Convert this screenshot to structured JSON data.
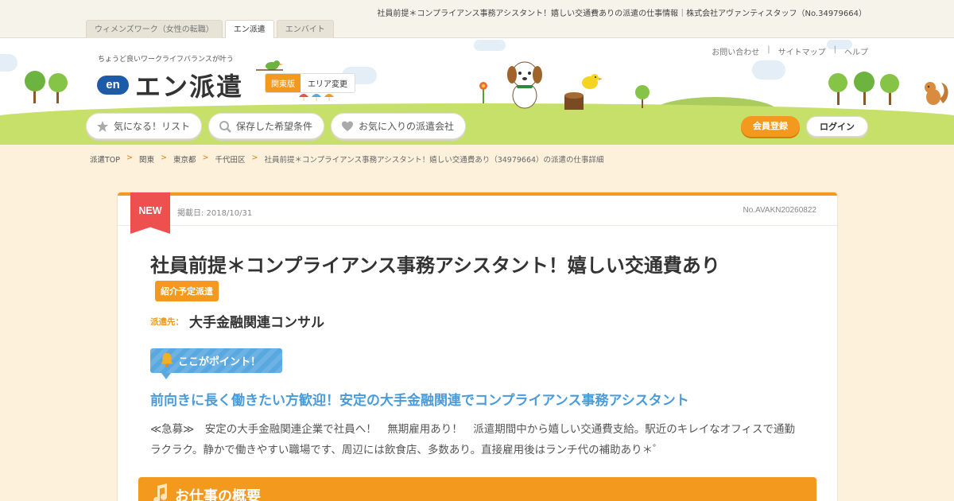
{
  "page_heading": "社員前提＊コンプライアンス事務アシスタント！嬉しい交通費ありの派遣の仕事情報｜株式会社アヴァンティスタッフ（No.34979664）",
  "site_tabs": [
    {
      "label": "ウィメンズワーク（女性の転職）",
      "active": false
    },
    {
      "label": "エン派遣",
      "active": true
    },
    {
      "label": "エンバイト",
      "active": false
    }
  ],
  "header": {
    "tagline": "ちょうど良いワークライフバランスが叶う",
    "logo_mark": "en",
    "logo_text": "エン派遣",
    "region": "関東版",
    "region_change": "エリア変更",
    "util_links": [
      "お問い合わせ",
      "サイトマップ",
      "ヘルプ"
    ],
    "nav": [
      {
        "label": "気になる！リスト",
        "icon": "star-icon"
      },
      {
        "label": "保存した希望条件",
        "icon": "search-icon"
      },
      {
        "label": "お気に入りの派遣会社",
        "icon": "heart-icon"
      }
    ],
    "register": "会員登録",
    "login": "ログイン"
  },
  "breadcrumb": [
    "派遣TOP",
    "関東",
    "東京都",
    "千代田区",
    "社員前提＊コンプライアンス事務アシスタント！嬉しい交通費あり（34979664）の派遣の仕事詳細"
  ],
  "job": {
    "badge_new": "NEW",
    "posted": "掲載日: 2018/10/31",
    "job_no": "No.AVAKN20260822",
    "title": "社員前提＊コンプライアンス事務アシスタント！嬉しい交通費あり",
    "tag": "紹介予定派遣",
    "dest_label": "派遣先：",
    "dest_name": "大手金融関連コンサル",
    "point_label": "ここがポイント！",
    "catch": "前向きに長く働きたい方歓迎！安定の大手金融関連でコンプライアンス事務アシスタント",
    "description": "≪急募≫　安定の大手金融関連企業で社員へ！　無期雇用あり！　派遣期間中から嬉しい交通費支給。駅近のキレイなオフィスで通勤ラクラク。静かで働きやすい職場です、周辺には飲食店、多数あり。直接雇用後はランチ代の補助あり＊゜",
    "section_title": "お仕事の概要"
  },
  "colors": {
    "accent": "#f39a1e",
    "blue": "#4a9bd9",
    "new_red": "#ee4f4f",
    "brand_blue": "#1d5aa8"
  }
}
